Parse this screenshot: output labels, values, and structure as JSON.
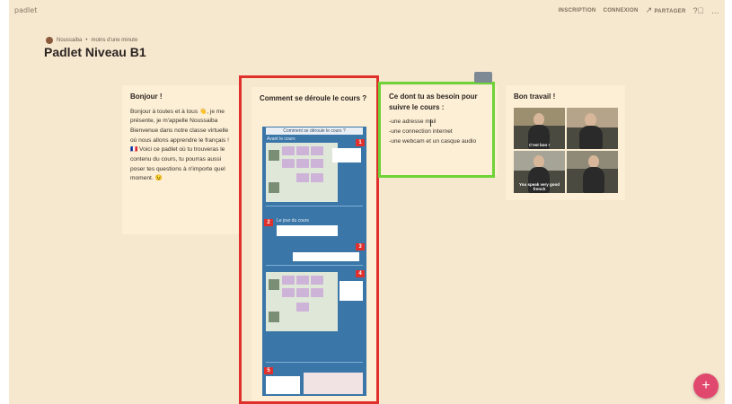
{
  "app": {
    "logo": "padlet"
  },
  "header": {
    "inscription": "INSCRIPTION",
    "connexion": "CONNEXION",
    "partager": "PARTAGER",
    "partager_icon": "share-arrow-icon",
    "help_icon": "question-circle-icon",
    "more_icon": "more-horizontal-icon"
  },
  "board": {
    "author": "Noussaiba",
    "separator": "•",
    "time": "moins d'une minute",
    "title": "Padlet Niveau B1"
  },
  "columns": [
    {
      "title": "Bonjour !",
      "body": "Bonjour à toutes et à tous 👋, je me présente, je m'appelle Noussaiba Bienvenue dans notre classe virtuelle où nous allons apprendre le français ! 🇫🇷 Voici ce padlet où tu trouveras le contenu du cours, tu pourras aussi poser tes questions à n'importe quel moment. 😉"
    },
    {
      "title": "Comment se déroule le cours ?",
      "embed_title": "Comment se déroule le cours ?",
      "sections": [
        "Avant le cours",
        "Le jour du cours"
      ],
      "badges": [
        "1",
        "2",
        "3",
        "4",
        "5"
      ]
    },
    {
      "title": "Ce dont tu as besoin pour suivre le cours :",
      "lines": [
        "-une adresse mail",
        "-une connection internet",
        "-une webcam et un casque audio"
      ]
    },
    {
      "title": "Bon travail !",
      "captions": [
        "C'est bon !",
        "You speak very good french"
      ]
    }
  ],
  "fab": {
    "label": "+"
  },
  "colors": {
    "board_bg": "#f6e7cf",
    "card_bg": "#fcefd5",
    "highlight_red": "#e0302c",
    "highlight_green": "#6fd236",
    "fab": "#e0486d"
  }
}
